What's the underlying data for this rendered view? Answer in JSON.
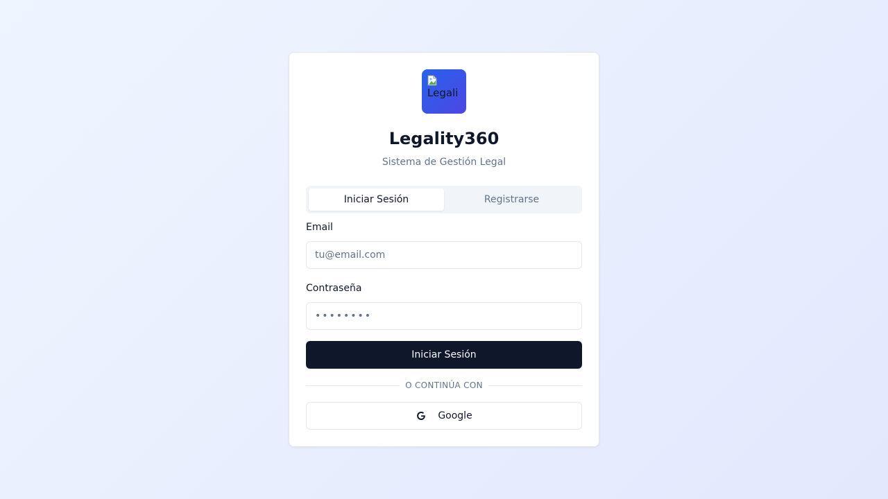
{
  "app": {
    "logo_alt": "Legali",
    "title": "Legality360",
    "subtitle": "Sistema de Gestión Legal"
  },
  "tabs": [
    {
      "label": "Iniciar Sesión",
      "active": true
    },
    {
      "label": "Registrarse",
      "active": false
    }
  ],
  "form": {
    "email_label": "Email",
    "email_placeholder": "tu@email.com",
    "email_value": "",
    "password_label": "Contraseña",
    "password_placeholder": "••••••••",
    "password_value": "",
    "submit_label": "Iniciar Sesión"
  },
  "divider": {
    "text": "O continúa con"
  },
  "social": {
    "google_label": "Google",
    "google_icon": "google-icon"
  },
  "colors": {
    "primary": "#0f172a",
    "logo_gradient_start": "#2563eb",
    "logo_gradient_end": "#4f46e5",
    "muted_text": "#64748b",
    "border": "#e2e8f0"
  }
}
